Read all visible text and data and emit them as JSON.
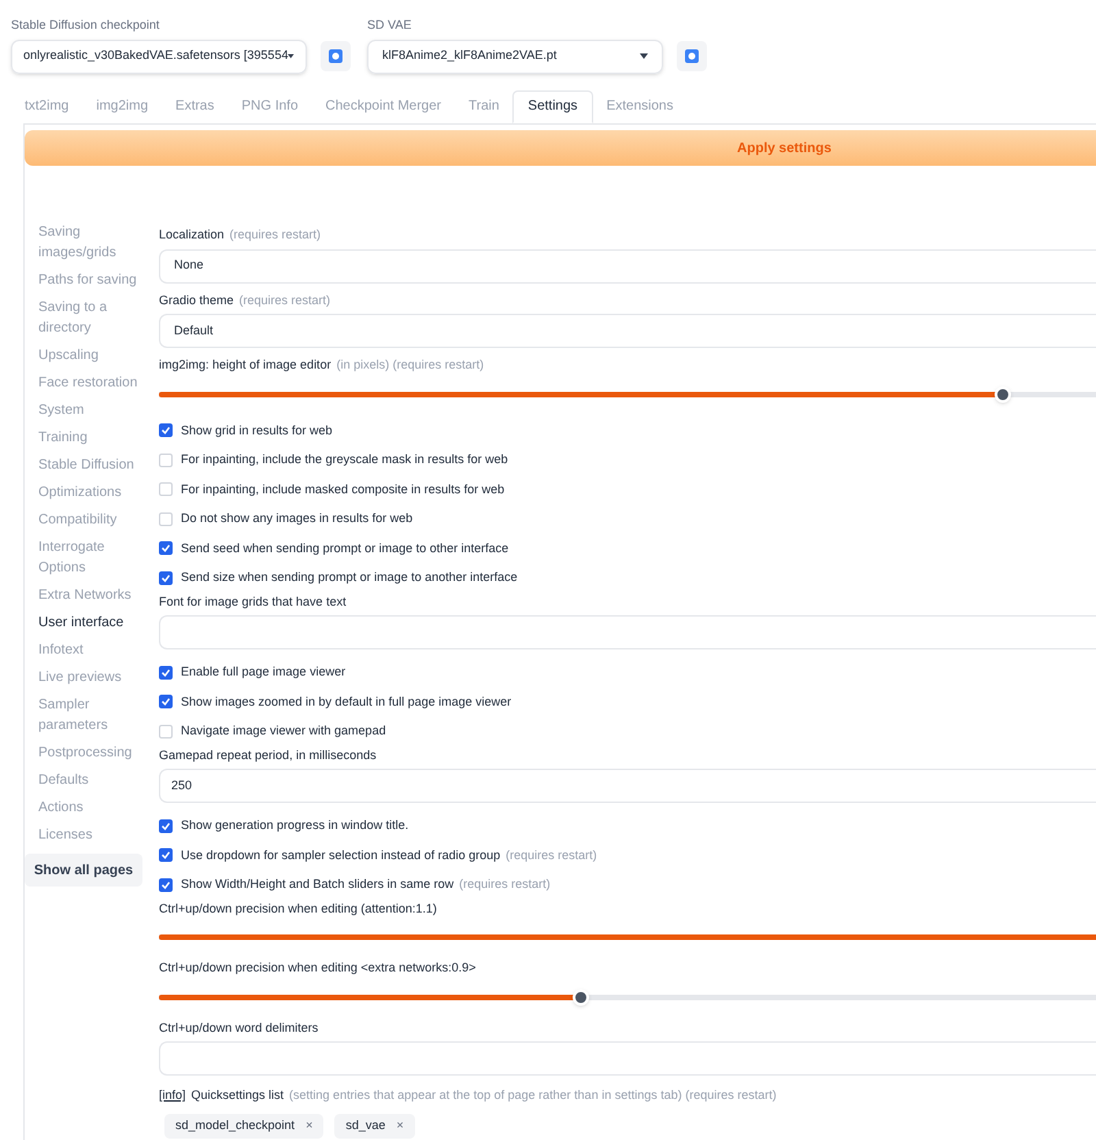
{
  "checkpoint": {
    "label": "Stable Diffusion checkpoint",
    "value": "onlyrealistic_v30BakedVAE.safetensors [395554"
  },
  "vae": {
    "label": "SD VAE",
    "value": "klF8Anime2_klF8Anime2VAE.pt"
  },
  "tabs": [
    {
      "label": "txt2img",
      "selected": false
    },
    {
      "label": "img2img",
      "selected": false
    },
    {
      "label": "Extras",
      "selected": false
    },
    {
      "label": "PNG Info",
      "selected": false
    },
    {
      "label": "Checkpoint Merger",
      "selected": false
    },
    {
      "label": "Train",
      "selected": false
    },
    {
      "label": "Settings",
      "selected": true
    },
    {
      "label": "Extensions",
      "selected": false
    }
  ],
  "apply_button": "Apply settings",
  "sidebar": {
    "items": [
      {
        "label": "Saving images/grids",
        "selected": false
      },
      {
        "label": "Paths for saving",
        "selected": false
      },
      {
        "label": "Saving to a directory",
        "selected": false
      },
      {
        "label": "Upscaling",
        "selected": false
      },
      {
        "label": "Face restoration",
        "selected": false
      },
      {
        "label": "System",
        "selected": false
      },
      {
        "label": "Training",
        "selected": false
      },
      {
        "label": "Stable Diffusion",
        "selected": false
      },
      {
        "label": "Optimizations",
        "selected": false
      },
      {
        "label": "Compatibility",
        "selected": false
      },
      {
        "label": "Interrogate Options",
        "selected": false
      },
      {
        "label": "Extra Networks",
        "selected": false
      },
      {
        "label": "User interface",
        "selected": true
      },
      {
        "label": "Infotext",
        "selected": false
      },
      {
        "label": "Live previews",
        "selected": false
      },
      {
        "label": "Sampler parameters",
        "selected": false
      },
      {
        "label": "Postprocessing",
        "selected": false
      },
      {
        "label": "Defaults",
        "selected": false
      },
      {
        "label": "Actions",
        "selected": false
      },
      {
        "label": "Licenses",
        "selected": false
      }
    ],
    "show_all_button": "Show all pages"
  },
  "settings": [
    {
      "kind": "dropdown",
      "label": "Localization",
      "note": "(requires restart)",
      "value": "None"
    },
    {
      "kind": "dropdown",
      "label": "Gradio theme",
      "note": "(requires restart)",
      "value": "Default"
    },
    {
      "kind": "slider",
      "label": "img2img: height of image editor",
      "note": "(in pixels) (requires restart)",
      "level": 0.9
    },
    {
      "kind": "checkbox",
      "label": "Show grid in results for web",
      "checked": true
    },
    {
      "kind": "checkbox",
      "label": "For inpainting, include the greyscale mask in results for web",
      "checked": false
    },
    {
      "kind": "checkbox",
      "label": "For inpainting, include masked composite in results for web",
      "checked": false
    },
    {
      "kind": "checkbox",
      "label": "Do not show any images in results for web",
      "checked": false
    },
    {
      "kind": "checkbox",
      "label": "Send seed when sending prompt or image to other interface",
      "checked": true
    },
    {
      "kind": "checkbox",
      "label": "Send size when sending prompt or image to another interface",
      "checked": true
    },
    {
      "kind": "textbox",
      "label": "Font for image grids that have text"
    },
    {
      "kind": "checkbox",
      "label": "Enable full page image viewer",
      "checked": true
    },
    {
      "kind": "checkbox",
      "label": "Show images zoomed in by default in full page image viewer",
      "checked": true
    },
    {
      "kind": "checkbox",
      "label": "Navigate image viewer with gamepad",
      "checked": false
    },
    {
      "kind": "textbox",
      "label": "Gamepad repeat period, in milliseconds",
      "value": "250"
    },
    {
      "kind": "checkbox",
      "label": "Show generation progress in window title.",
      "checked": true
    },
    {
      "kind": "checkbox",
      "label": "Use dropdown for sampler selection instead of radio group",
      "note": "(requires restart)",
      "checked": true
    },
    {
      "kind": "checkbox",
      "label": "Show Width/Height and Batch sliders in same row",
      "note": "(requires restart)",
      "checked": true
    },
    {
      "kind": "slider",
      "label": "Ctrl+up/down precision when editing (attention:1.1)",
      "level": 1
    },
    {
      "kind": "slider",
      "label": "Ctrl+up/down precision when editing <extra networks:0.9>",
      "level": 0.45
    },
    {
      "kind": "textbox",
      "label": "Ctrl+up/down word delimiters"
    },
    {
      "kind": "chips",
      "info": "[info]",
      "label": "Quicksettings list",
      "note": "(setting entries that appear at the top of page rather than in settings tab) (requires restart)",
      "chips": [
        {
          "label": "sd_model_checkpoint",
          "remove": "×"
        },
        {
          "label": "sd_vae",
          "remove": "×"
        }
      ]
    }
  ]
}
